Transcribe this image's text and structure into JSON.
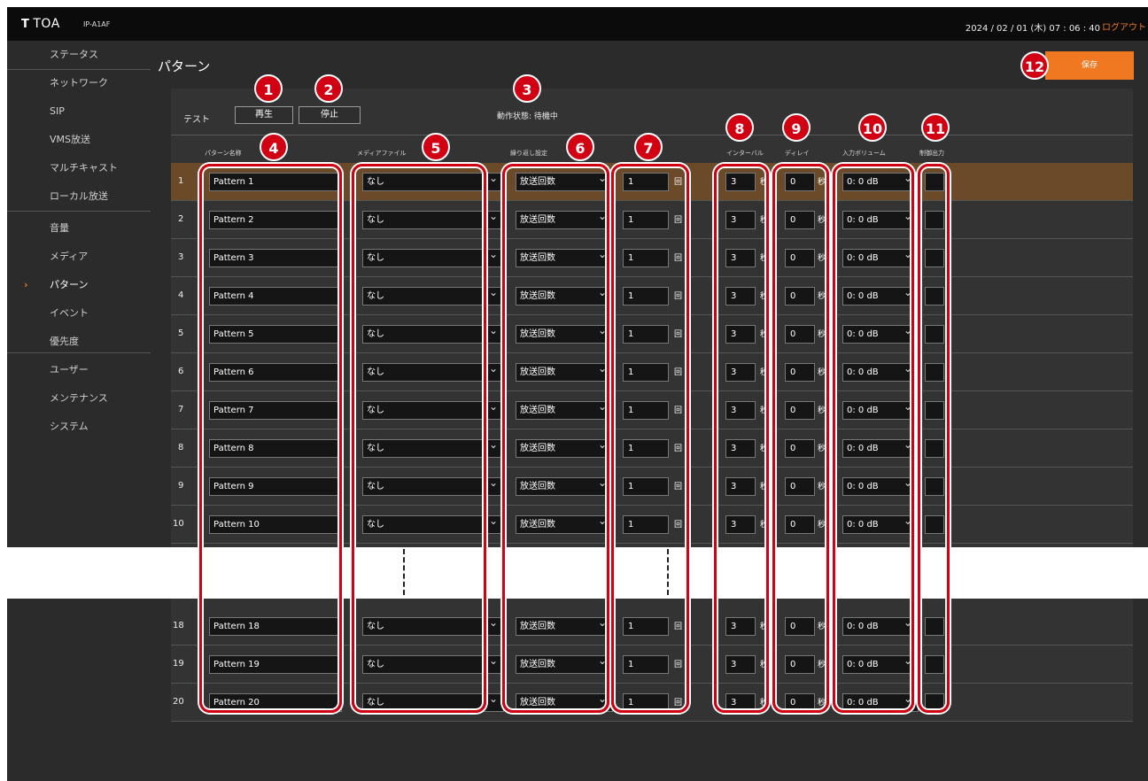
{
  "header": {
    "logo_mark": "T",
    "logo_text": "TOA",
    "model": "IP-A1AF",
    "datetime": "2024 / 02 / 01 (木)   07 : 06 : 40",
    "logout": "ログアウト"
  },
  "sidebar": {
    "items": [
      {
        "label": "ステータス"
      },
      {
        "label": "ネットワーク"
      },
      {
        "label": "SIP"
      },
      {
        "label": "VMS放送"
      },
      {
        "label": "マルチキャスト"
      },
      {
        "label": "ローカル放送"
      },
      {
        "label": "音量"
      },
      {
        "label": "メディア"
      },
      {
        "label": "パターン"
      },
      {
        "label": "イベント"
      },
      {
        "label": "優先度"
      },
      {
        "label": "ユーザー"
      },
      {
        "label": "メンテナンス"
      },
      {
        "label": "システム"
      }
    ],
    "active_index": 8,
    "chevron": "›"
  },
  "main": {
    "title": "パターン",
    "save_label": "保存",
    "test_label": "テスト",
    "play_label": "再生",
    "stop_label": "停止",
    "state_label": "動作状態:",
    "state_value": "待機中",
    "columns": {
      "name": "パターン名称",
      "media": "メディアファイル",
      "repeat": "繰り返し設定",
      "interval": "インターバル",
      "delay": "ディレイ",
      "input_volume": "入力ボリューム",
      "control_output": "制御出力"
    },
    "units": {
      "times": "回",
      "seconds": "秒"
    },
    "rows_upper": [
      {
        "num": "1",
        "name": "Pattern 1",
        "media": "なし",
        "repeat": "放送回数",
        "count": "1",
        "interval": "3",
        "delay": "0",
        "volume": "0: 0 dB"
      },
      {
        "num": "2",
        "name": "Pattern 2",
        "media": "なし",
        "repeat": "放送回数",
        "count": "1",
        "interval": "3",
        "delay": "0",
        "volume": "0: 0 dB"
      },
      {
        "num": "3",
        "name": "Pattern 3",
        "media": "なし",
        "repeat": "放送回数",
        "count": "1",
        "interval": "3",
        "delay": "0",
        "volume": "0: 0 dB"
      },
      {
        "num": "4",
        "name": "Pattern 4",
        "media": "なし",
        "repeat": "放送回数",
        "count": "1",
        "interval": "3",
        "delay": "0",
        "volume": "0: 0 dB"
      },
      {
        "num": "5",
        "name": "Pattern 5",
        "media": "なし",
        "repeat": "放送回数",
        "count": "1",
        "interval": "3",
        "delay": "0",
        "volume": "0: 0 dB"
      },
      {
        "num": "6",
        "name": "Pattern 6",
        "media": "なし",
        "repeat": "放送回数",
        "count": "1",
        "interval": "3",
        "delay": "0",
        "volume": "0: 0 dB"
      },
      {
        "num": "7",
        "name": "Pattern 7",
        "media": "なし",
        "repeat": "放送回数",
        "count": "1",
        "interval": "3",
        "delay": "0",
        "volume": "0: 0 dB"
      },
      {
        "num": "8",
        "name": "Pattern 8",
        "media": "なし",
        "repeat": "放送回数",
        "count": "1",
        "interval": "3",
        "delay": "0",
        "volume": "0: 0 dB"
      },
      {
        "num": "9",
        "name": "Pattern 9",
        "media": "なし",
        "repeat": "放送回数",
        "count": "1",
        "interval": "3",
        "delay": "0",
        "volume": "0: 0 dB"
      },
      {
        "num": "10",
        "name": "Pattern 10",
        "media": "なし",
        "repeat": "放送回数",
        "count": "1",
        "interval": "3",
        "delay": "0",
        "volume": "0: 0 dB"
      }
    ],
    "rows_lower": [
      {
        "num": "18",
        "name": "Pattern 18",
        "media": "なし",
        "repeat": "放送回数",
        "count": "1",
        "interval": "3",
        "delay": "0",
        "volume": "0: 0 dB"
      },
      {
        "num": "19",
        "name": "Pattern 19",
        "media": "なし",
        "repeat": "放送回数",
        "count": "1",
        "interval": "3",
        "delay": "0",
        "volume": "0: 0 dB"
      },
      {
        "num": "20",
        "name": "Pattern 20",
        "media": "なし",
        "repeat": "放送回数",
        "count": "1",
        "interval": "3",
        "delay": "0",
        "volume": "0: 0 dB"
      }
    ]
  },
  "callouts": [
    "1",
    "2",
    "3",
    "4",
    "5",
    "6",
    "7",
    "8",
    "9",
    "10",
    "11",
    "12"
  ],
  "colors": {
    "accent": "#f07820",
    "callout": "#d10012",
    "selected_row": "#6b4a2a"
  }
}
